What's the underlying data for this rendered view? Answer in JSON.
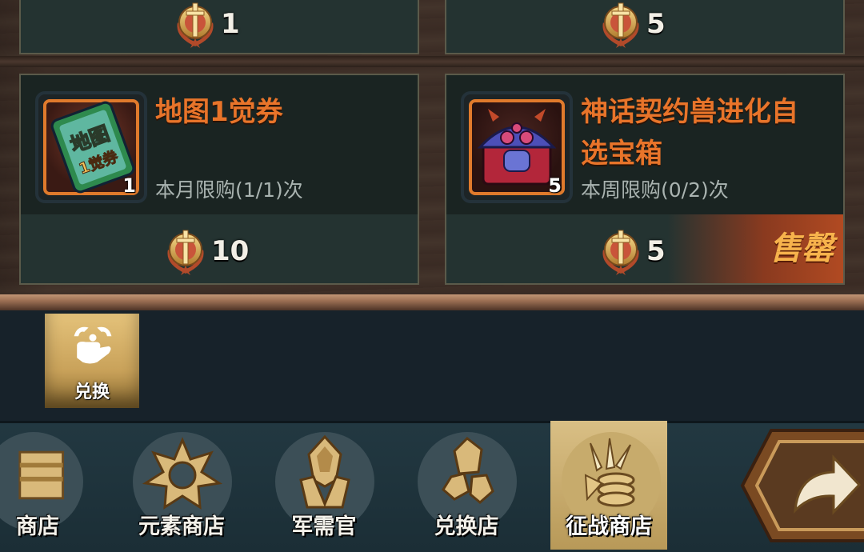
{
  "shop_items": [
    {
      "price": "1"
    },
    {
      "price": "5"
    },
    {
      "name": "地图1觉券",
      "quantity": "1",
      "limit": "本月限购(1/1)次",
      "price": "10",
      "icon": "map-awakening-ticket-icon"
    },
    {
      "name_line1": "神话契约兽进化自",
      "name_line2": "选宝箱",
      "quantity": "5",
      "limit": "本周限购(0/2)次",
      "price": "5",
      "status": "售罄",
      "icon": "mythic-beast-chest-icon"
    }
  ],
  "currency_icon": "conquest-medal-icon",
  "sub_tabs": [
    {
      "label": "兑换",
      "icon": "exchange-hands-icon"
    }
  ],
  "nav": [
    {
      "label": "商店",
      "icon": "shop-icon"
    },
    {
      "label": "元素商店",
      "icon": "element-star-icon"
    },
    {
      "label": "军需官",
      "icon": "quartermaster-icon"
    },
    {
      "label": "兑换店",
      "icon": "crystal-icon"
    },
    {
      "label": "征战商店",
      "icon": "conquest-coins-icon",
      "active": true
    }
  ],
  "back_button_icon": "return-arrow-icon"
}
